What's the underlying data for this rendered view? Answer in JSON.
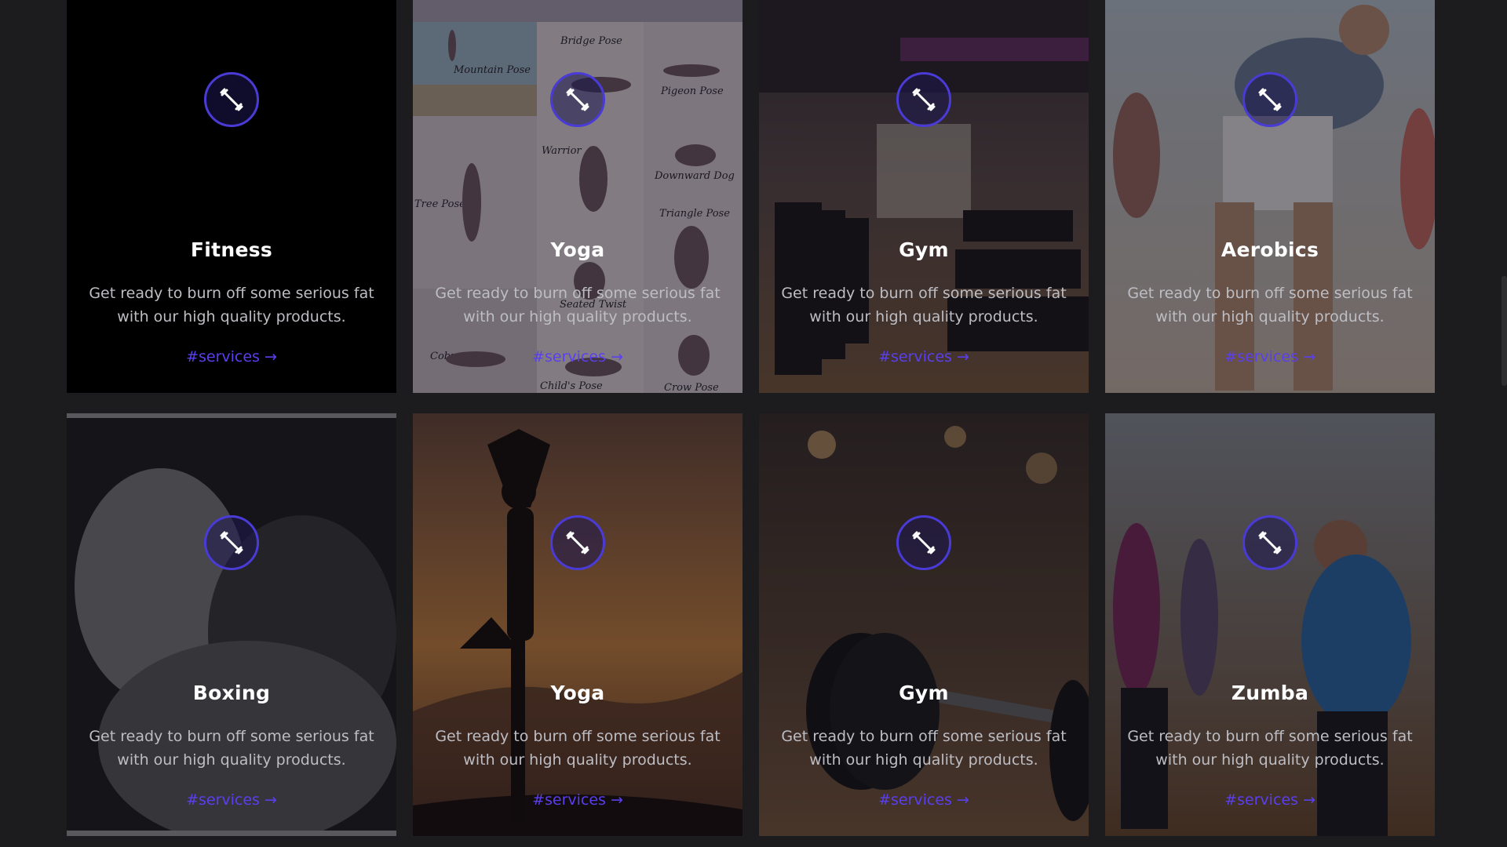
{
  "colors": {
    "page_background": "#1c1c1e",
    "accent": "#5a3ff0",
    "icon_ring": "#4a3bd6"
  },
  "cards": [
    {
      "title": "Fitness",
      "description": "Get ready to burn off some serious fat with our high quality products.",
      "link": "#services →",
      "icon": "dumbbell-icon",
      "image": "plain black background"
    },
    {
      "title": "Yoga",
      "description": "Get ready to burn off some serious fat with our high quality products.",
      "link": "#services →",
      "icon": "dumbbell-icon",
      "image": "yoga poses chart",
      "image_labels": [
        "Mountain Pose",
        "Bridge Pose",
        "Pigeon Pose",
        "Warrior",
        "Downward Dog",
        "Tree Pose",
        "Triangle Pose",
        "Seated Twist",
        "Cobra",
        "Child's Pose",
        "Crow Pose"
      ]
    },
    {
      "title": "Gym",
      "description": "Get ready to burn off some serious fat with our high quality products.",
      "link": "#services →",
      "icon": "dumbbell-icon",
      "image": "gym with treadmills"
    },
    {
      "title": "Aerobics",
      "description": "Get ready to burn off some serious fat with our high quality products.",
      "link": "#services →",
      "icon": "dumbbell-icon",
      "image": "aerobics class stretching"
    },
    {
      "title": "Boxing",
      "description": "Get ready to burn off some serious fat with our high quality products.",
      "link": "#services →",
      "icon": "dumbbell-icon",
      "image": "black and white boxer"
    },
    {
      "title": "Yoga",
      "description": "Get ready to burn off some serious fat with our high quality products.",
      "link": "#services →",
      "icon": "dumbbell-icon",
      "image": "yoga silhouette at sunset"
    },
    {
      "title": "Gym",
      "description": "Get ready to burn off some serious fat with our high quality products.",
      "link": "#services →",
      "icon": "dumbbell-icon",
      "image": "barbell weight plates in gym"
    },
    {
      "title": "Zumba",
      "description": "Get ready to burn off some serious fat with our high quality products.",
      "link": "#services →",
      "icon": "dumbbell-icon",
      "image": "zumba dance class"
    }
  ]
}
